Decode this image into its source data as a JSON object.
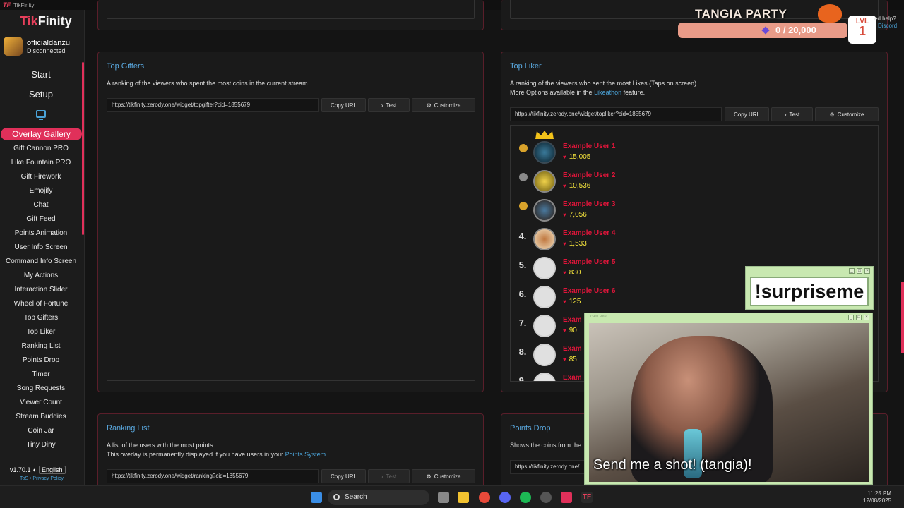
{
  "window": {
    "app_title": "TikFinity",
    "logo_mark": "TF"
  },
  "sidebar": {
    "logo_a": "Tik",
    "logo_b": "Finity",
    "username": "officialdanzu",
    "status": "Disconnected",
    "start": "Start",
    "setup": "Setup",
    "active": "Overlay Gallery",
    "items": [
      "Gift Cannon PRO",
      "Like Fountain PRO",
      "Gift Firework",
      "Emojify",
      "Chat",
      "Gift Feed",
      "Points Animation",
      "User Info Screen",
      "Command Info Screen",
      "My Actions",
      "Interaction Slider",
      "Wheel of Fortune",
      "Top Gifters",
      "Top Liker",
      "Ranking List",
      "Points Drop",
      "Timer",
      "Song Requests",
      "Viewer Count",
      "Stream Buddies",
      "Coin Jar",
      "Tiny Diny"
    ],
    "version": "v1.70.1",
    "language": "English",
    "tos": "ToS",
    "sep": "•",
    "privacy": "Privacy Policy"
  },
  "top_gifters": {
    "title": "Top Gifters",
    "desc": "A ranking of the viewers who spent the most coins in the current stream.",
    "url": "https://tikfinity.zerody.one/widget/topgifter?cid=1855679",
    "copy": "Copy URL",
    "test": "Test",
    "customize": "Customize"
  },
  "top_liker": {
    "title": "Top Liker",
    "desc1": "A ranking of the viewers who sent the most Likes (Taps on screen).",
    "desc2a": "More Options available in the",
    "desc2link": "Likeathon",
    "desc2b": "feature.",
    "url": "https://tikfinity.zerody.one/widget/topliker?cid=1855679",
    "copy": "Copy URL",
    "test": "Test",
    "customize": "Customize",
    "users": [
      {
        "rank": "",
        "name": "Example User 1",
        "likes": "15,005"
      },
      {
        "rank": "",
        "name": "Example User 2",
        "likes": "10,536"
      },
      {
        "rank": "",
        "name": "Example User 3",
        "likes": "7,056"
      },
      {
        "rank": "4.",
        "name": "Example User 4",
        "likes": "1,533"
      },
      {
        "rank": "5.",
        "name": "Example User 5",
        "likes": "830"
      },
      {
        "rank": "6.",
        "name": "Example User 6",
        "likes": "125"
      },
      {
        "rank": "7.",
        "name": "Exam",
        "likes": "90"
      },
      {
        "rank": "8.",
        "name": "Exam",
        "likes": "85"
      },
      {
        "rank": "9.",
        "name": "Exam",
        "likes": ""
      }
    ]
  },
  "ranking_list": {
    "title": "Ranking List",
    "desc1": "A list of the users with the most points.",
    "desc2a": "This overlay is permanently displayed if you have users in your",
    "desc2link": "Points System",
    "desc2b": ".",
    "url": "https://tikfinity.zerody.one/widget/ranking?cid=1855679",
    "copy": "Copy URL",
    "test": "Test",
    "customize": "Customize"
  },
  "points_drop": {
    "title": "Points Drop",
    "desc": "Shows the coins from the",
    "url": "https://tikfinity.zerody.one/"
  },
  "overlay": {
    "party_title": "TANGIA PARTY",
    "party_count": "0 / 20,000",
    "lvl_label": "LVL",
    "lvl_value": "1",
    "help": "ed help?",
    "discord": "Discord",
    "surprise": "!surpriseme",
    "cam_title": "cam.exe",
    "caption": "Send me a shot! (tangia)!"
  },
  "taskbar": {
    "search": "Search",
    "time": "11:25 PM",
    "date": "12/08/2025"
  },
  "colors": {
    "accent": "#e0305a",
    "link": "#4aa3d8",
    "name_red": "#e0153a",
    "likes_yellow": "#f5e43c"
  }
}
